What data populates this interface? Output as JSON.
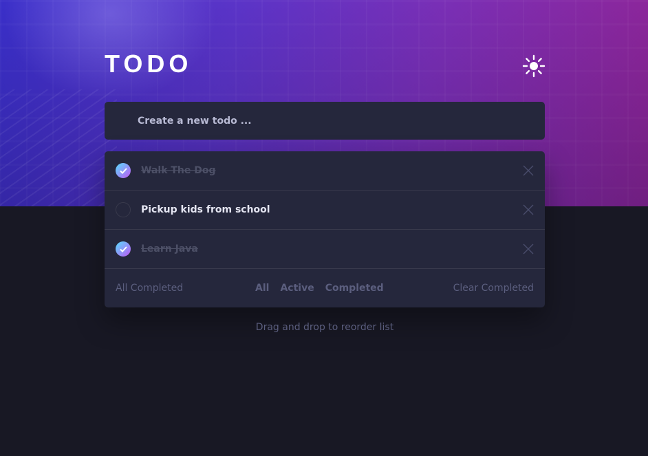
{
  "app": {
    "title": "TODO"
  },
  "theme_toggle": {
    "icon": "sun-icon"
  },
  "new_todo": {
    "placeholder": "Create a new todo ..."
  },
  "todos": [
    {
      "text": "Walk The Dog",
      "completed": true
    },
    {
      "text": "Pickup kids from school",
      "completed": false
    },
    {
      "text": "Learn Java",
      "completed": true
    }
  ],
  "footer": {
    "status": "All Completed",
    "filters": [
      "All",
      "Active",
      "Completed"
    ],
    "clear": "Clear Completed"
  },
  "hint": "Drag and drop to reorder list",
  "colors": {
    "background": "#181824",
    "card": "#25273c",
    "check_gradient_start": "#57ddff",
    "check_gradient_end": "#c058f3",
    "muted": "#5b5e7e"
  }
}
